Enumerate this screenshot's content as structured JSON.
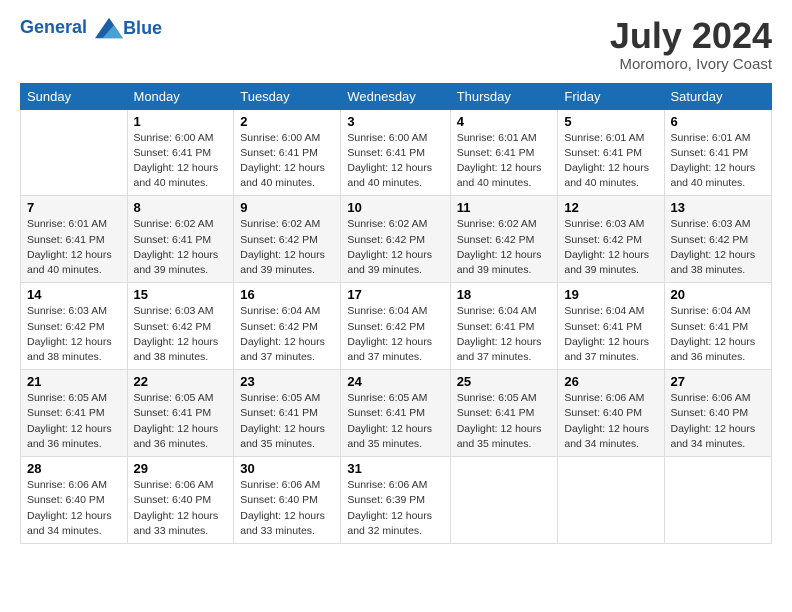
{
  "header": {
    "logo_line1": "General",
    "logo_line2": "Blue",
    "month": "July 2024",
    "location": "Moromoro, Ivory Coast"
  },
  "weekdays": [
    "Sunday",
    "Monday",
    "Tuesday",
    "Wednesday",
    "Thursday",
    "Friday",
    "Saturday"
  ],
  "weeks": [
    [
      {
        "day": "",
        "info": ""
      },
      {
        "day": "1",
        "info": "Sunrise: 6:00 AM\nSunset: 6:41 PM\nDaylight: 12 hours\nand 40 minutes."
      },
      {
        "day": "2",
        "info": "Sunrise: 6:00 AM\nSunset: 6:41 PM\nDaylight: 12 hours\nand 40 minutes."
      },
      {
        "day": "3",
        "info": "Sunrise: 6:00 AM\nSunset: 6:41 PM\nDaylight: 12 hours\nand 40 minutes."
      },
      {
        "day": "4",
        "info": "Sunrise: 6:01 AM\nSunset: 6:41 PM\nDaylight: 12 hours\nand 40 minutes."
      },
      {
        "day": "5",
        "info": "Sunrise: 6:01 AM\nSunset: 6:41 PM\nDaylight: 12 hours\nand 40 minutes."
      },
      {
        "day": "6",
        "info": "Sunrise: 6:01 AM\nSunset: 6:41 PM\nDaylight: 12 hours\nand 40 minutes."
      }
    ],
    [
      {
        "day": "7",
        "info": "Sunrise: 6:01 AM\nSunset: 6:41 PM\nDaylight: 12 hours\nand 40 minutes."
      },
      {
        "day": "8",
        "info": "Sunrise: 6:02 AM\nSunset: 6:41 PM\nDaylight: 12 hours\nand 39 minutes."
      },
      {
        "day": "9",
        "info": "Sunrise: 6:02 AM\nSunset: 6:42 PM\nDaylight: 12 hours\nand 39 minutes."
      },
      {
        "day": "10",
        "info": "Sunrise: 6:02 AM\nSunset: 6:42 PM\nDaylight: 12 hours\nand 39 minutes."
      },
      {
        "day": "11",
        "info": "Sunrise: 6:02 AM\nSunset: 6:42 PM\nDaylight: 12 hours\nand 39 minutes."
      },
      {
        "day": "12",
        "info": "Sunrise: 6:03 AM\nSunset: 6:42 PM\nDaylight: 12 hours\nand 39 minutes."
      },
      {
        "day": "13",
        "info": "Sunrise: 6:03 AM\nSunset: 6:42 PM\nDaylight: 12 hours\nand 38 minutes."
      }
    ],
    [
      {
        "day": "14",
        "info": "Sunrise: 6:03 AM\nSunset: 6:42 PM\nDaylight: 12 hours\nand 38 minutes."
      },
      {
        "day": "15",
        "info": "Sunrise: 6:03 AM\nSunset: 6:42 PM\nDaylight: 12 hours\nand 38 minutes."
      },
      {
        "day": "16",
        "info": "Sunrise: 6:04 AM\nSunset: 6:42 PM\nDaylight: 12 hours\nand 37 minutes."
      },
      {
        "day": "17",
        "info": "Sunrise: 6:04 AM\nSunset: 6:42 PM\nDaylight: 12 hours\nand 37 minutes."
      },
      {
        "day": "18",
        "info": "Sunrise: 6:04 AM\nSunset: 6:41 PM\nDaylight: 12 hours\nand 37 minutes."
      },
      {
        "day": "19",
        "info": "Sunrise: 6:04 AM\nSunset: 6:41 PM\nDaylight: 12 hours\nand 37 minutes."
      },
      {
        "day": "20",
        "info": "Sunrise: 6:04 AM\nSunset: 6:41 PM\nDaylight: 12 hours\nand 36 minutes."
      }
    ],
    [
      {
        "day": "21",
        "info": "Sunrise: 6:05 AM\nSunset: 6:41 PM\nDaylight: 12 hours\nand 36 minutes."
      },
      {
        "day": "22",
        "info": "Sunrise: 6:05 AM\nSunset: 6:41 PM\nDaylight: 12 hours\nand 36 minutes."
      },
      {
        "day": "23",
        "info": "Sunrise: 6:05 AM\nSunset: 6:41 PM\nDaylight: 12 hours\nand 35 minutes."
      },
      {
        "day": "24",
        "info": "Sunrise: 6:05 AM\nSunset: 6:41 PM\nDaylight: 12 hours\nand 35 minutes."
      },
      {
        "day": "25",
        "info": "Sunrise: 6:05 AM\nSunset: 6:41 PM\nDaylight: 12 hours\nand 35 minutes."
      },
      {
        "day": "26",
        "info": "Sunrise: 6:06 AM\nSunset: 6:40 PM\nDaylight: 12 hours\nand 34 minutes."
      },
      {
        "day": "27",
        "info": "Sunrise: 6:06 AM\nSunset: 6:40 PM\nDaylight: 12 hours\nand 34 minutes."
      }
    ],
    [
      {
        "day": "28",
        "info": "Sunrise: 6:06 AM\nSunset: 6:40 PM\nDaylight: 12 hours\nand 34 minutes."
      },
      {
        "day": "29",
        "info": "Sunrise: 6:06 AM\nSunset: 6:40 PM\nDaylight: 12 hours\nand 33 minutes."
      },
      {
        "day": "30",
        "info": "Sunrise: 6:06 AM\nSunset: 6:40 PM\nDaylight: 12 hours\nand 33 minutes."
      },
      {
        "day": "31",
        "info": "Sunrise: 6:06 AM\nSunset: 6:39 PM\nDaylight: 12 hours\nand 32 minutes."
      },
      {
        "day": "",
        "info": ""
      },
      {
        "day": "",
        "info": ""
      },
      {
        "day": "",
        "info": ""
      }
    ]
  ]
}
